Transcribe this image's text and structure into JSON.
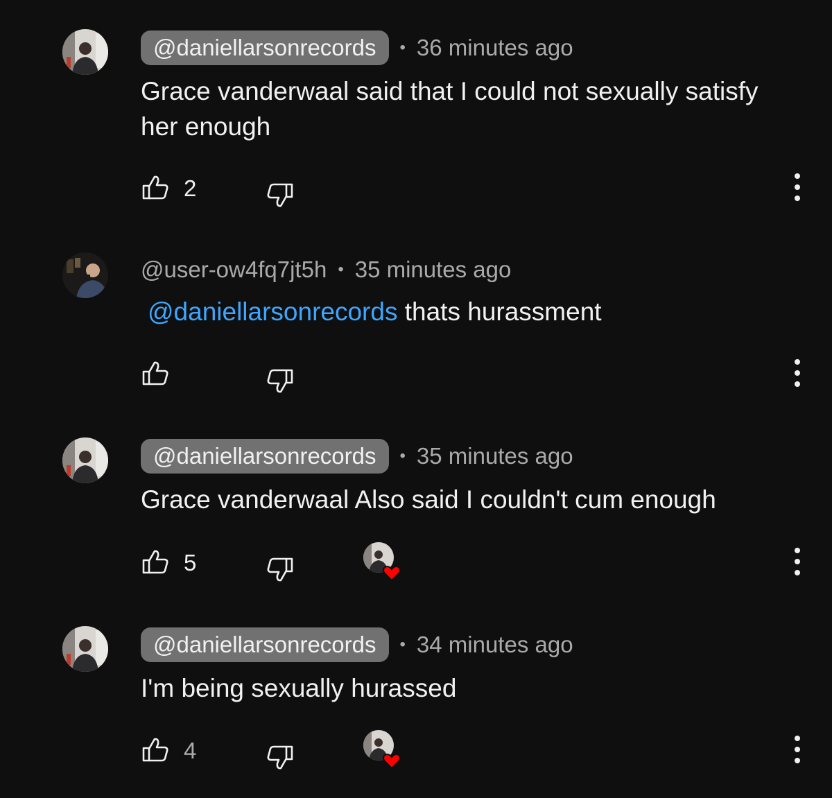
{
  "comments": [
    {
      "author": "@daniellarsonrecords",
      "time": "36 minutes ago",
      "text": "Grace vanderwaal said that I could not sexually satisfy her enough",
      "likes": "2",
      "author_style": "chip",
      "hearted": false
    },
    {
      "author": "@user-ow4fq7jt5h",
      "time": "35 minutes ago",
      "mention": "@daniellarsonrecords",
      "text": " thats hurassment",
      "likes": "",
      "author_style": "plain",
      "hearted": false
    },
    {
      "author": "@daniellarsonrecords",
      "time": "35 minutes ago",
      "text": "Grace vanderwaal Also said I couldn't cum enough",
      "likes": "5",
      "author_style": "chip",
      "hearted": true
    },
    {
      "author": "@daniellarsonrecords",
      "time": "34 minutes ago",
      "text": "I'm being sexually hurassed",
      "likes": "4",
      "author_style": "chip",
      "hearted": true
    }
  ],
  "separator": "•",
  "colors": {
    "background": "#0f0f0f",
    "text": "#f1f1f1",
    "secondary": "#aaaaaa",
    "chip": "#717171",
    "mention": "#3ea6ff",
    "heart": "#ff0000"
  },
  "icons": {
    "like": "thumbs-up-icon",
    "dislike": "thumbs-down-icon",
    "more": "more-vert-icon",
    "heart": "creator-heart-icon"
  }
}
